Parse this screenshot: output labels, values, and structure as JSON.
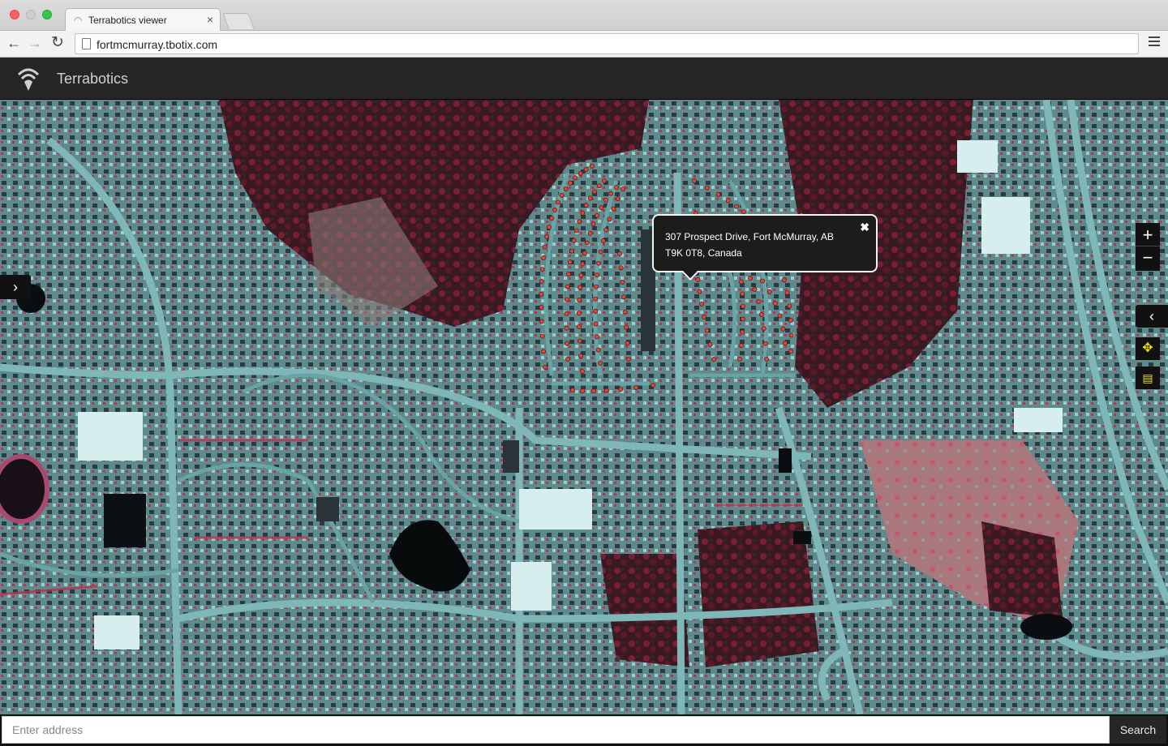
{
  "browser": {
    "tab_title": "Terrabotics viewer",
    "tab_close": "×",
    "url": "fortmcmurray.tbotix.com",
    "icons": {
      "back": "arrow-left-icon",
      "forward": "arrow-right-icon",
      "reload": "reload-icon",
      "menu": "hamburger-menu-icon"
    }
  },
  "app": {
    "brand": "Terrabotics"
  },
  "map": {
    "popup": {
      "line1": "307 Prospect Drive, Fort McMurray, AB",
      "line2": "T9K 0T8, Canada",
      "close": "✖"
    },
    "controls": {
      "zoom_in": "+",
      "zoom_out": "−",
      "open_panel": "›",
      "collapse_panel": "‹",
      "move_tool": "✥",
      "note_tool": "▤"
    },
    "marker_color": "#e8432e"
  },
  "search": {
    "placeholder": "Enter address",
    "button": "Search"
  }
}
